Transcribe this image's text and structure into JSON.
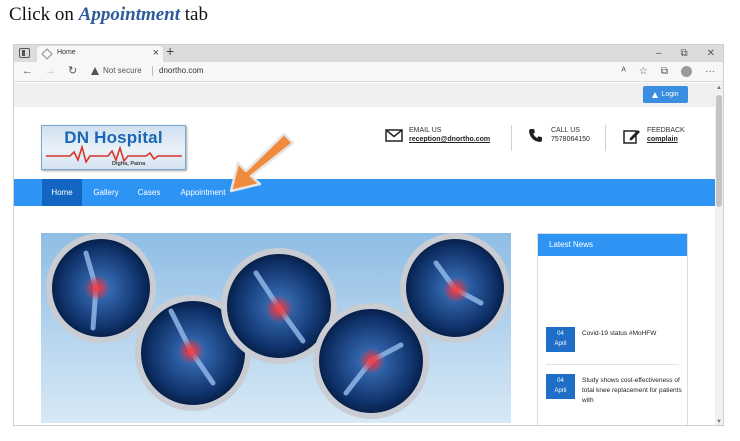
{
  "instruction": {
    "prefix": "Click on ",
    "target": "Appointment",
    "suffix": " tab"
  },
  "browser": {
    "tab_title": "Home",
    "tab_close": "×",
    "new_tab": "+",
    "window_controls": {
      "minimize": "–",
      "restore": "⧉",
      "close": "✕"
    },
    "nav": {
      "back": "←",
      "forward": "→",
      "reload": "↻"
    },
    "address": {
      "security_label": "Not secure",
      "url": "dnortho.com"
    },
    "toolbar_icons": {
      "read_aloud": "ᴬ",
      "favorites": "☆",
      "collections": "⧉",
      "menu": "···"
    }
  },
  "site": {
    "login_label": "Login",
    "logo": {
      "name": "DN Hospital",
      "location": "Digha, Patna"
    },
    "contacts": [
      {
        "label": "EMAIL US",
        "value": "reception@dnortho.com"
      },
      {
        "label": "CALL US",
        "value": "7578064150"
      },
      {
        "label": "FEEDBACK",
        "value": "complain"
      }
    ],
    "nav_items": [
      "Home",
      "Gallery",
      "Cases",
      "Appointment"
    ],
    "news": {
      "heading": "Latest News",
      "items": [
        {
          "day": "04",
          "month": "April",
          "text": "Covid-19 status #MoHFW"
        },
        {
          "day": "04",
          "month": "April",
          "text": "Study shows cost-effectiveness of total knee replacement for patients with"
        }
      ]
    }
  },
  "colors": {
    "nav_blue": "#2d94f4",
    "nav_active": "#1266c2",
    "accent_arrow": "#f08a3c"
  }
}
